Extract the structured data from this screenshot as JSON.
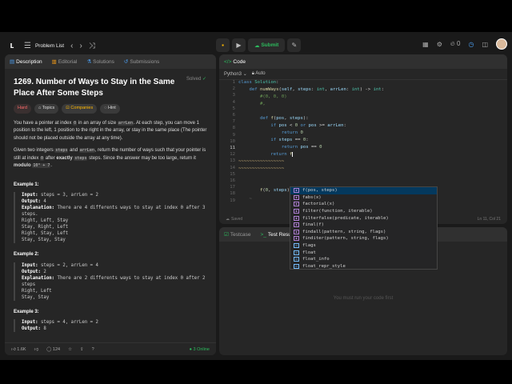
{
  "topbar": {
    "problem_list": "Problem List",
    "submit": "Submit",
    "count": "0"
  },
  "left": {
    "tabs": [
      "Description",
      "Editorial",
      "Solutions",
      "Submissions"
    ],
    "title": "1269. Number of Ways to Stay in the Same Place After Some Steps",
    "solved": "Solved",
    "tags": {
      "difficulty": "Hard",
      "topics": "Topics",
      "companies": "Companies",
      "hint": "Hint"
    },
    "desc1_a": "You have a pointer at index ",
    "desc1_code1": "0",
    "desc1_b": " in an array of size ",
    "desc1_code2": "arrLen",
    "desc1_c": ". At each step, you can move 1 position to the left, 1 position to the right in the array, or stay in the same place (The pointer should not be placed outside the array at any time).",
    "desc2_a": "Given two integers ",
    "desc2_code1": "steps",
    "desc2_b": " and ",
    "desc2_code2": "arrLen",
    "desc2_c": ", return the number of ways such that your pointer is still at index ",
    "desc2_code3": "0",
    "desc2_d": " after ",
    "desc2_bold1": "exactly",
    "desc2_code4": "steps",
    "desc2_e": " steps. Since the answer may be too large, return it ",
    "desc2_bold2": "modulo",
    "desc2_code5": "10⁹ + 7",
    "desc2_f": ".",
    "examples": [
      {
        "head": "Example 1:",
        "input": "steps = 3, arrLen = 2",
        "output": "4",
        "explanation": "There are 4 differents ways to stay at index 0 after 3\nsteps.\nRight, Left, Stay\nStay, Right, Left\nRight, Stay, Left\nStay, Stay, Stay"
      },
      {
        "head": "Example 2:",
        "input": "steps = 2, arrLen = 4",
        "output": "2",
        "explanation": "There are 2 differents ways to stay at index 0 after 2\nsteps\nRight, Left\nStay, Stay"
      },
      {
        "head": "Example 3:",
        "input": "steps = 4, arrLen = 2",
        "output": "8"
      }
    ],
    "labels": {
      "input": "Input:",
      "output": "Output:",
      "explanation": "Explanation:"
    },
    "footer": {
      "likes": "1.6K",
      "comments": "124",
      "online": "3 Online"
    }
  },
  "code": {
    "tab": "Code",
    "language": "Python3",
    "auto": "Auto",
    "saved": "Saved",
    "cursor": "Ln 11, Col 21",
    "line_numbers": [
      "1",
      "2",
      "3",
      "4",
      "5",
      "6",
      "7",
      "8",
      "9",
      "10",
      "11",
      "12",
      "13",
      "14",
      "15",
      "16",
      "17",
      "18",
      "19"
    ],
    "suggestions": [
      "f(pos, steps)",
      "fabs(x)",
      "factorial(x)",
      "filter(function, iterable)",
      "filterfalse(predicate, iterable)",
      "final(f)",
      "findall(pattern, string, flags)",
      "finditer(pattern, string, flags)",
      "flags",
      "float",
      "float_info",
      "float_repr_style"
    ]
  },
  "result": {
    "tabs": [
      "Testcase",
      "Test Result"
    ],
    "empty": "You must run your code first"
  }
}
